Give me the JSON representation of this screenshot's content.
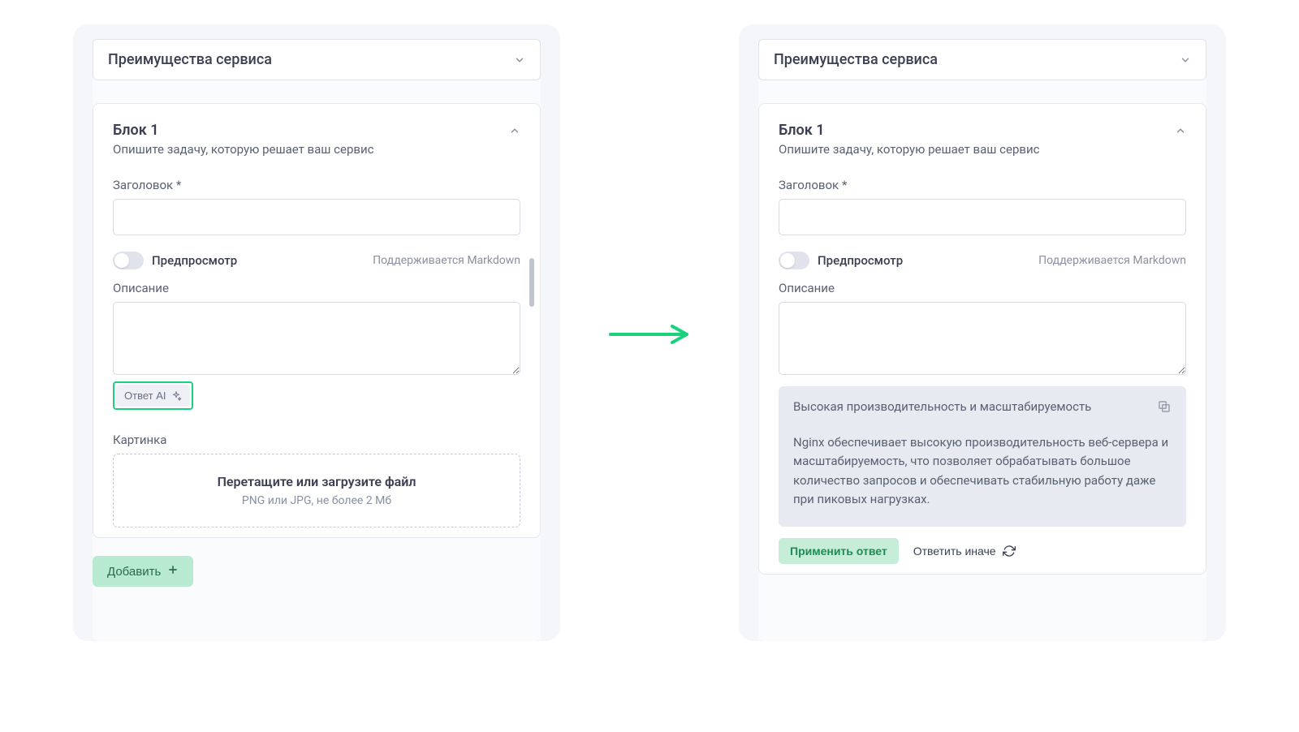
{
  "left": {
    "dropdown_label": "Преимущества сервиса",
    "block": {
      "title": "Блок 1",
      "subtitle": "Опишите задачу, которую решает ваш сервис",
      "heading_label": "Заголовок *",
      "preview_label": "Предпросмотр",
      "markdown_hint": "Поддерживается Markdown",
      "description_label": "Описание",
      "ai_button_label": "Ответ AI",
      "image_label": "Картинка",
      "dropzone_title": "Перетащите или загрузите файл",
      "dropzone_sub": "PNG или JPG, не более 2 Мб"
    },
    "add_button": "Добавить"
  },
  "right": {
    "dropdown_label": "Преимущества сервиса",
    "block": {
      "title": "Блок 1",
      "subtitle": "Опишите задачу, которую решает ваш сервис",
      "heading_label": "Заголовок *",
      "preview_label": "Предпросмотр",
      "markdown_hint": "Поддерживается Markdown",
      "description_label": "Описание",
      "ai_response": {
        "title": "Высокая производительность и масштабируемость",
        "body": "Nginx обеспечивает высокую производительность веб-сервера и масштабируемость, что позволяет обрабатывать большое количество запросов и обеспечивать стабильную работу даже при пиковых нагрузках."
      },
      "apply_label": "Применить ответ",
      "retry_label": "Ответить иначе"
    }
  }
}
